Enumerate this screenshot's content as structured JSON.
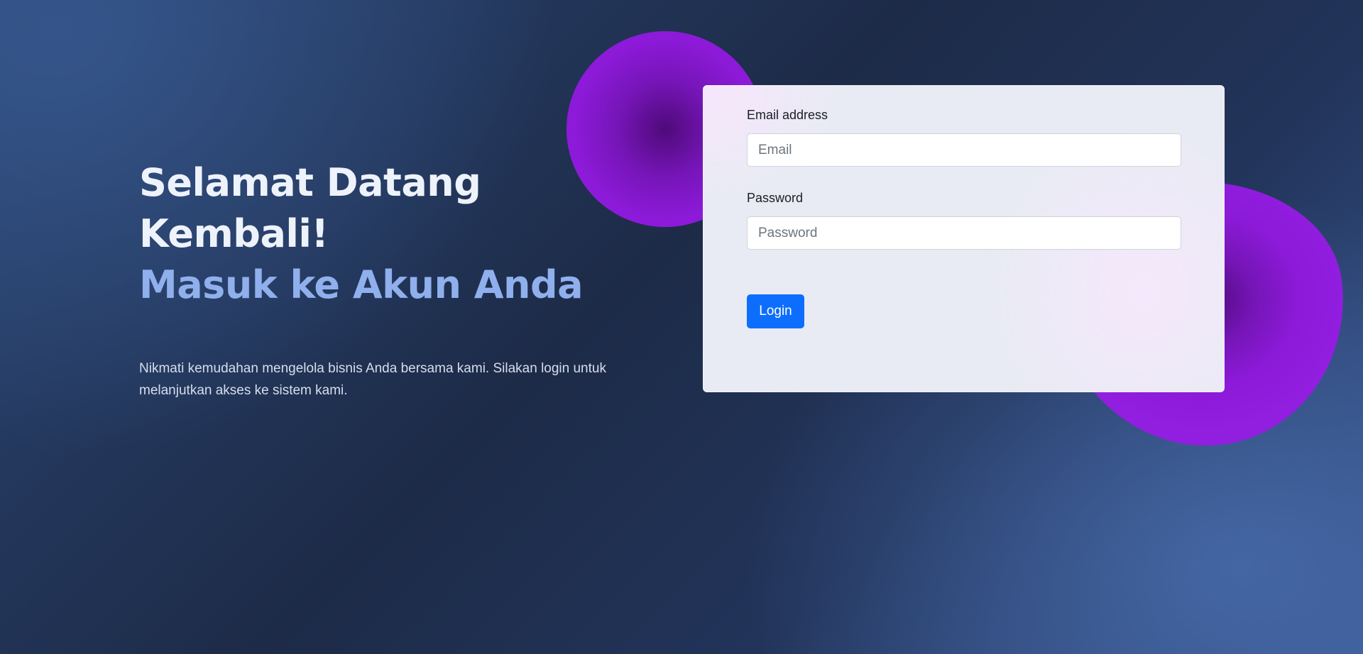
{
  "hero": {
    "title_line1": "Selamat Datang Kembali!",
    "title_line2": "Masuk ke Akun Anda",
    "description": "Nikmati kemudahan mengelola bisnis Anda bersama kami. Silakan login untuk melanjutkan akses ke sistem kami."
  },
  "login_form": {
    "email_label": "Email address",
    "email_placeholder": "Email",
    "email_value": "",
    "password_label": "Password",
    "password_placeholder": "Password",
    "password_value": "",
    "submit_label": "Login"
  },
  "colors": {
    "background_dark": "#1d2b48",
    "background_light": "#4466a3",
    "title_primary": "#eef2fb",
    "title_accent": "#8fb0ec",
    "blob_purple": "#921ee0",
    "button_primary": "#0d6efd",
    "card_background": "#e8ebf3"
  }
}
